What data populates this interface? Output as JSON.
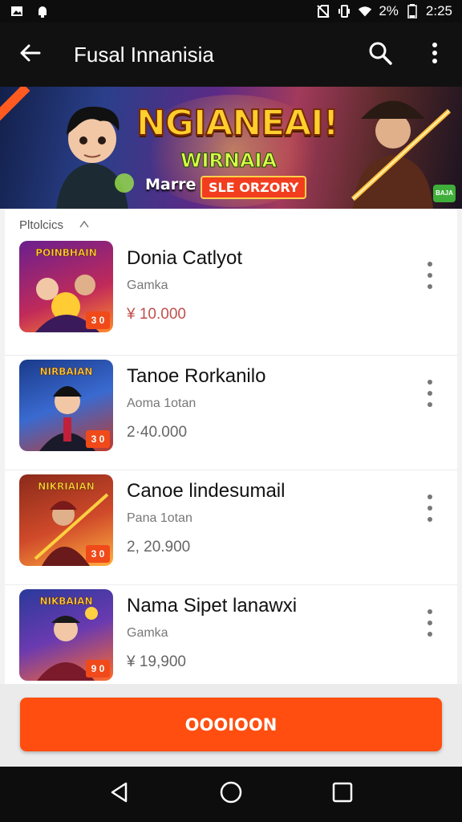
{
  "status_bar": {
    "battery": "2%",
    "time": "2:25",
    "icons": [
      "photo-icon",
      "android-icon",
      "no-sim-icon",
      "vibrate-icon",
      "wifi-icon",
      "battery-icon"
    ]
  },
  "app_bar": {
    "title": "Fusal Innanisia",
    "back_icon": "arrow-left-icon",
    "search_icon": "search-icon",
    "more_icon": "more-vert-icon"
  },
  "banner": {
    "headline": "NGIANEAI!",
    "subheadline": "WIRNAIA",
    "name": "Marre",
    "tag": "SLE ORZORY",
    "corner_badge": "BAJA"
  },
  "section": {
    "label": "Pltolcics",
    "chevron_icon": "chevron-up-icon"
  },
  "items": [
    {
      "title": "Donia Catlyot",
      "subtitle": "Gamka",
      "price": "¥ 10.000",
      "thumb_title": "POINBHAIN",
      "thumb_badge": "3 0",
      "accent": true
    },
    {
      "title": "Tanoe Rorkanilo",
      "subtitle": "Aoma 1otan",
      "price": "2·40.000",
      "thumb_title": "NIRBAIAN",
      "thumb_badge": "3 0",
      "accent": false
    },
    {
      "title": "Canoe lindesumail",
      "subtitle": "Pana 1otan",
      "price": "2, 20.900",
      "thumb_title": "NIKRIAIAN",
      "thumb_badge": "3 0",
      "accent": false
    },
    {
      "title": "Nama Sipet lanawxi",
      "subtitle": "Gamka",
      "price": "¥ 19,900",
      "thumb_title": "NIKBAIAN",
      "thumb_badge": "9 0",
      "accent": false
    }
  ],
  "cta": {
    "label": "OOOIOON"
  },
  "nav_bar": {
    "back_icon": "nav-back-icon",
    "home_icon": "nav-home-icon",
    "recents_icon": "nav-recents-icon"
  },
  "colors": {
    "accent": "#ff4e0f",
    "app_bar": "#111111",
    "price_accent": "#c0504d"
  }
}
